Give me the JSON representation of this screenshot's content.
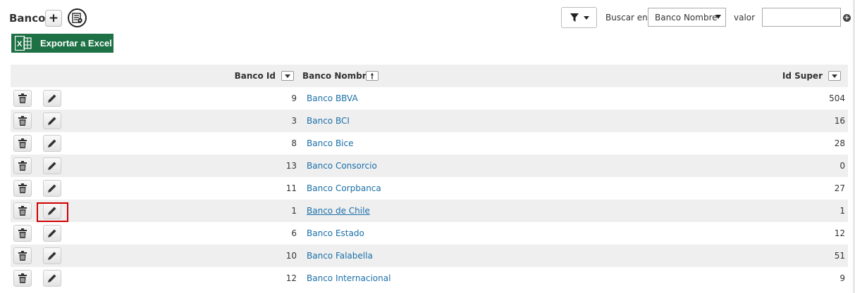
{
  "header": {
    "title": "Banco",
    "add_label": "+",
    "export_label": "Exportar a Excel"
  },
  "search": {
    "label": "Buscar en",
    "field_selected": "Banco Nombre",
    "value_label": "valor",
    "value": ""
  },
  "grid": {
    "columns": {
      "id": "Banco Id",
      "name": "Banco Nombre",
      "super": "Id Super"
    },
    "rows": [
      {
        "id": "9",
        "name": "Banco BBVA",
        "super": "504"
      },
      {
        "id": "3",
        "name": "Banco BCI",
        "super": "16"
      },
      {
        "id": "8",
        "name": "Banco Bice",
        "super": "28"
      },
      {
        "id": "13",
        "name": "Banco Consorcio",
        "super": "0"
      },
      {
        "id": "11",
        "name": "Banco Corpbanca",
        "super": "27"
      },
      {
        "id": "1",
        "name": "Banco de Chile",
        "super": "1"
      },
      {
        "id": "6",
        "name": "Banco Estado",
        "super": "12"
      },
      {
        "id": "10",
        "name": "Banco Falabella",
        "super": "51"
      },
      {
        "id": "12",
        "name": "Banco Internacional",
        "super": "9"
      }
    ]
  },
  "colors": {
    "excel_green": "#1e7145",
    "link_blue": "#1a6fa8",
    "highlight_red": "#d00000",
    "row_alt": "#efefef"
  },
  "icons": {
    "add": "plus-icon",
    "config": "settings-list-icon",
    "excel": "excel-icon",
    "filter": "filter-icon",
    "go": "plus-circle-icon",
    "delete": "trash-icon",
    "edit": "pencil-icon"
  }
}
